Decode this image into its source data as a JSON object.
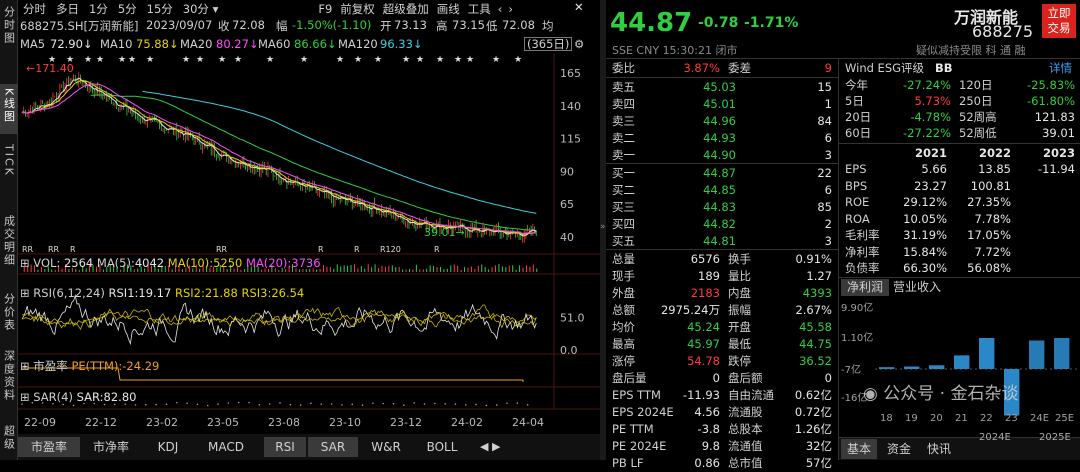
{
  "left_nav": {
    "items": [
      "分时图",
      "K线图",
      "TICK",
      "成交明细",
      "分价表",
      "深度资料",
      "超级"
    ],
    "active": "K线图"
  },
  "toolbar": {
    "items": [
      "分时",
      "多日",
      "1分",
      "5分",
      "15分",
      "30分 ▾"
    ],
    "right_items": [
      "F9",
      "前复权",
      "超级叠加",
      "画线",
      "工具"
    ]
  },
  "header": {
    "code": "688275.SH[万润新能]",
    "date": "2023/09/07",
    "close_label": "收",
    "close": "72.08",
    "chg_label": "幅",
    "chg": "-1.50%(-1.10)",
    "open_label": "开",
    "open": "73.13",
    "high_label": "高",
    "high": "73.15",
    "low_label": "低",
    "low": "72.08",
    "avg_label": "均",
    "range": "(365日)"
  },
  "ma_legend": [
    {
      "label": "MA5",
      "value": "72.90↓",
      "color": "#e6e6e6"
    },
    {
      "label": "MA10",
      "value": "75.88↓",
      "color": "#e6d200"
    },
    {
      "label": "MA20",
      "value": "80.27↓",
      "color": "#ff4dff"
    },
    {
      "label": "MA60",
      "value": "86.66↓",
      "color": "#2fcf3f"
    },
    {
      "label": "MA120",
      "value": "96.33↓",
      "color": "#39d0e0"
    }
  ],
  "kline": {
    "high_marker": "171.40",
    "low_marker": "39.01",
    "y_ticks": [
      "165",
      "140",
      "115",
      "90",
      "65",
      "40"
    ],
    "rr_labels": [
      "RR",
      "RR",
      "R",
      "RR",
      "R",
      "R",
      "R120",
      "R"
    ]
  },
  "vol_panel": {
    "label": "VOL:",
    "vol": "2564",
    "ma5_label": "MA(5):",
    "ma5": "4042",
    "ma10_label": "MA(10):",
    "ma10": "5250",
    "ma20_label": "MA(20):",
    "ma20": "3736"
  },
  "rsi_panel": {
    "label": "RSI(6,12,24)",
    "rsi1_label": "RSI1:",
    "rsi1": "19.17",
    "rsi2_label": "RSI2:",
    "rsi2": "21.88",
    "rsi3_label": "RSI3:",
    "rsi3": "26.54",
    "ticks": [
      "51.0",
      "0.0"
    ]
  },
  "pe_panel": {
    "label": "市盈率",
    "pe_label": "PE(TTM):",
    "pe": "-24.29"
  },
  "sar_panel": {
    "label": "SAR(4)",
    "sar_label": "SAR:",
    "sar": "82.80"
  },
  "x_axis": [
    "22-09",
    "22-12",
    "23-02",
    "23-05",
    "23-08",
    "23-10",
    "23-12",
    "24-02",
    "24-04"
  ],
  "bottom_tabs": [
    "市盈率",
    "市净率",
    "KDJ",
    "MACD",
    "RSI",
    "SAR",
    "W&R",
    "BOLL"
  ],
  "bottom_active": [
    "市盈率",
    "RSI",
    "SAR"
  ],
  "quote": {
    "price": "44.87",
    "chg": "-0.78",
    "pct": "-1.71%",
    "name": "万润新能",
    "code": "688275",
    "exchange": "SSE",
    "currency": "CNY",
    "time": "15:30:21",
    "status": "闭市",
    "tags": "疑似减持受限 科 通 融",
    "trade_btn": "立即交易"
  },
  "order_book": {
    "ratio_label": "委比",
    "ratio": "3.87%",
    "diff_label": "委差",
    "diff": "9",
    "asks": [
      {
        "label": "卖五",
        "price": "45.03",
        "vol": "15"
      },
      {
        "label": "卖四",
        "price": "45.01",
        "vol": "1"
      },
      {
        "label": "卖三",
        "price": "44.96",
        "vol": "84"
      },
      {
        "label": "卖二",
        "price": "44.93",
        "vol": "6"
      },
      {
        "label": "卖一",
        "price": "44.90",
        "vol": "3"
      }
    ],
    "bids": [
      {
        "label": "买一",
        "price": "44.87",
        "vol": "22"
      },
      {
        "label": "买二",
        "price": "44.85",
        "vol": "6"
      },
      {
        "label": "买三",
        "price": "44.83",
        "vol": "85"
      },
      {
        "label": "买四",
        "price": "44.82",
        "vol": "2"
      },
      {
        "label": "买五",
        "price": "44.81",
        "vol": "3"
      }
    ]
  },
  "stats": [
    {
      "l1": "总量",
      "v1": "6576",
      "c1": "wht",
      "l2": "换手",
      "v2": "0.91%",
      "c2": "wht"
    },
    {
      "l1": "现手",
      "v1": "189",
      "c1": "wht",
      "l2": "量比",
      "v2": "1.27",
      "c2": "wht"
    },
    {
      "l1": "外盘",
      "v1": "2183",
      "c1": "red",
      "l2": "内盘",
      "v2": "4393",
      "c2": "grn"
    },
    {
      "l1": "总额",
      "v1": "2975.24万",
      "c1": "wht",
      "l2": "振幅",
      "v2": "2.67%",
      "c2": "wht"
    },
    {
      "l1": "均价",
      "v1": "45.24",
      "c1": "grn",
      "l2": "开盘",
      "v2": "45.58",
      "c2": "grn"
    },
    {
      "l1": "最高",
      "v1": "45.97",
      "c1": "grn",
      "l2": "最低",
      "v2": "44.75",
      "c2": "grn"
    },
    {
      "l1": "涨停",
      "v1": "54.78",
      "c1": "red",
      "l2": "跌停",
      "v2": "36.52",
      "c2": "grn"
    },
    {
      "l1": "盘后量",
      "v1": "0",
      "c1": "wht",
      "l2": "盘后额",
      "v2": "0",
      "c2": "wht"
    },
    {
      "l1": "EPS TTM",
      "v1": "-11.93",
      "c1": "wht",
      "l2": "自由流通",
      "v2": "0.62亿",
      "c2": "wht"
    },
    {
      "l1": "EPS 2024E",
      "v1": "4.56",
      "c1": "wht",
      "l2": "流通股",
      "v2": "0.72亿",
      "c2": "wht"
    },
    {
      "l1": "PE TTM",
      "v1": "-3.8",
      "c1": "wht",
      "l2": "总股本",
      "v2": "1.26亿",
      "c2": "wht"
    },
    {
      "l1": "PE 2024E",
      "v1": "9.8",
      "c1": "wht",
      "l2": "流通值",
      "v2": "32亿",
      "c2": "wht"
    },
    {
      "l1": "PB LF",
      "v1": "0.86",
      "c1": "wht",
      "l2": "总市值",
      "v2": "57亿",
      "c2": "wht"
    }
  ],
  "esg": {
    "label": "Wind ESG评级",
    "rating": "BB",
    "detail": "详情"
  },
  "perf": [
    {
      "l1": "今年",
      "v1": "-27.24%",
      "c1": "grn",
      "l2": "120日",
      "v2": "-25.83%",
      "c2": "grn"
    },
    {
      "l1": "5日",
      "v1": "5.73%",
      "c1": "red",
      "l2": "250日",
      "v2": "-61.80%",
      "c2": "grn"
    },
    {
      "l1": "20日",
      "v1": "-4.78%",
      "c1": "grn",
      "l2": "52周高",
      "v2": "121.83",
      "c2": "wht"
    },
    {
      "l1": "60日",
      "v1": "-27.22%",
      "c1": "grn",
      "l2": "52周低",
      "v2": "39.01",
      "c2": "wht"
    }
  ],
  "fin": {
    "years": [
      "2021",
      "2022",
      "2023"
    ],
    "rows": [
      {
        "label": "EPS",
        "vals": [
          "5.66",
          "13.85",
          "-11.94"
        ]
      },
      {
        "label": "BPS",
        "vals": [
          "23.27",
          "100.81",
          ""
        ]
      },
      {
        "label": "ROE",
        "vals": [
          "29.12%",
          "27.35%",
          ""
        ]
      },
      {
        "label": "ROA",
        "vals": [
          "10.05%",
          "7.78%",
          ""
        ]
      },
      {
        "label": "毛利率",
        "vals": [
          "31.19%",
          "17.05%",
          ""
        ]
      },
      {
        "label": "净利率",
        "vals": [
          "15.84%",
          "7.72%",
          ""
        ]
      },
      {
        "label": "负债率",
        "vals": [
          "66.30%",
          "56.08%",
          ""
        ]
      }
    ]
  },
  "mini_tabs": [
    "净利润",
    "营业收入"
  ],
  "mini_chart": {
    "y_ticks": [
      "9.90亿",
      "1.10亿",
      "-7亿",
      "-16亿"
    ],
    "x_labels": [
      "18",
      "19",
      "20",
      "21",
      "22",
      "23",
      "24E",
      "25E"
    ],
    "values": [
      0.3,
      0.4,
      0.6,
      2.2,
      5.0,
      -7.5,
      4.6,
      5.0
    ]
  },
  "watermark": "公众号 · 金石杂谈",
  "bottom_right_tabs": [
    "基本",
    "资金",
    "快讯"
  ],
  "bottom_right_tags": [
    "2024E",
    "2025E"
  ],
  "colors": {
    "up": "#ff3b3b",
    "down": "#2fcf3f",
    "ma5": "#e6e6e6",
    "ma10": "#e6d200",
    "ma20": "#ff4dff",
    "ma60": "#2fcf3f",
    "ma120": "#39d0e0",
    "accent": "#3a9cf0"
  }
}
